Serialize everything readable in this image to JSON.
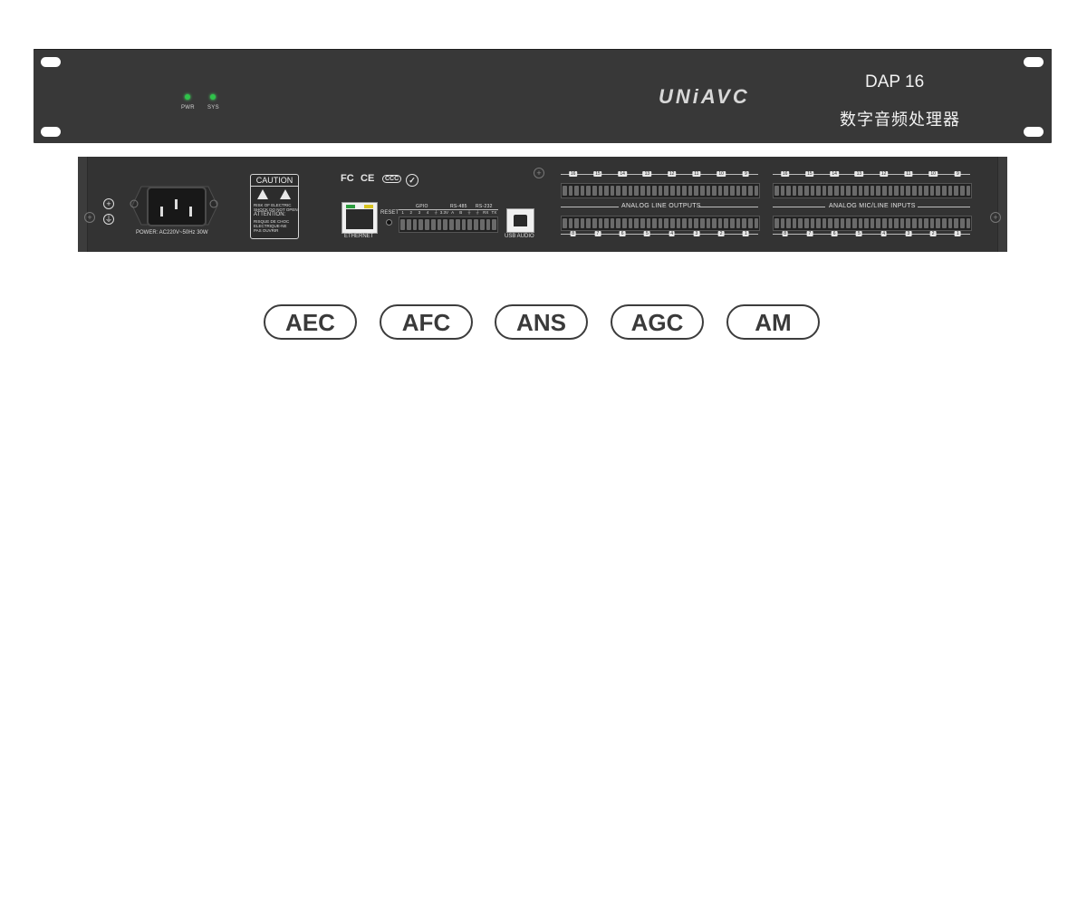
{
  "front_panel": {
    "leds": [
      {
        "label": "PWR",
        "color": "#2fc34a"
      },
      {
        "label": "SYS",
        "color": "#2fc34a"
      }
    ],
    "brand": "UNiAVC",
    "model": "DAP 16",
    "description": "数字音频处理器"
  },
  "rear_panel": {
    "power_label": "POWER: AC220V~50Hz 30W",
    "caution": {
      "title": "CAUTION",
      "line1": "RISK OF ELECTRIC",
      "line2": "SHOCK DO NOT OPEN",
      "line3": "ATTENTION:",
      "line4": "RISQUE DE CHOC",
      "line5": "ELECTRIQUE-NE",
      "line6": "PAS OUVRIR"
    },
    "certifications": [
      "FC",
      "CE",
      "CCC",
      "✓"
    ],
    "ethernet_label": "ETHERNET",
    "reset_label": "RESET",
    "gpio_label": "GPIO",
    "rs485_label": "RS-485",
    "rs232_label": "RS-232",
    "gpio_pins": [
      "1",
      "2",
      "3",
      "4",
      "⏚",
      "3.3V",
      "A",
      "B",
      "⏚",
      "⏚",
      "RX",
      "TX"
    ],
    "usb_label": "USB AUDIO",
    "outputs_label": "ANALOG LINE OUTPUTS",
    "inputs_label": "ANALOG  MIC/LINE  INPUTS",
    "output_channels_top": [
      "16",
      "15",
      "14",
      "13",
      "12",
      "11",
      "10",
      "9"
    ],
    "output_channels_bottom": [
      "8",
      "7",
      "6",
      "5",
      "4",
      "3",
      "2",
      "1"
    ],
    "input_channels_top": [
      "16",
      "15",
      "14",
      "13",
      "12",
      "11",
      "10",
      "9"
    ],
    "input_channels_bottom": [
      "8",
      "7",
      "6",
      "5",
      "4",
      "3",
      "2",
      "1"
    ]
  },
  "features": [
    "AEC",
    "AFC",
    "ANS",
    "AGC",
    "AM"
  ]
}
